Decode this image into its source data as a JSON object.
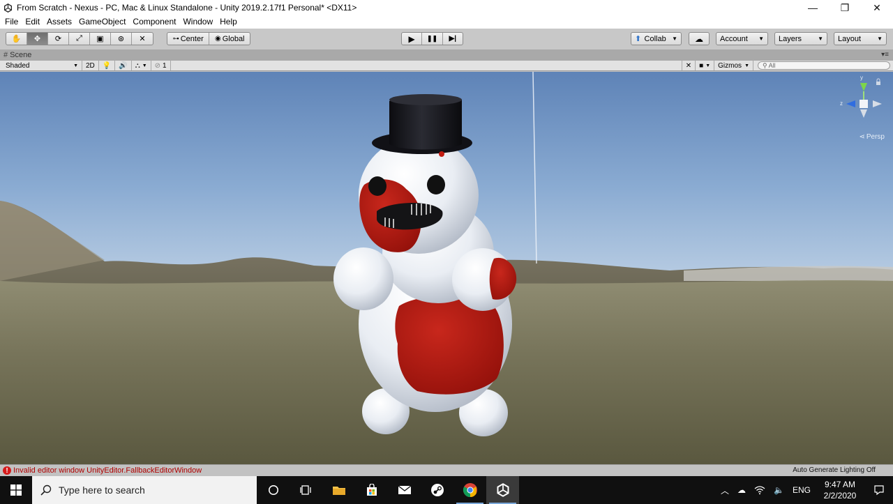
{
  "window": {
    "title": "From Scratch - Nexus - PC, Mac & Linux Standalone - Unity 2019.2.17f1 Personal* <DX11>",
    "minimize_glyph": "—",
    "maximize_glyph": "❐",
    "close_glyph": "✕"
  },
  "menu": [
    "File",
    "Edit",
    "Assets",
    "GameObject",
    "Component",
    "Window",
    "Help"
  ],
  "toolbar": {
    "transform_tools": [
      {
        "name": "hand-tool-icon",
        "glyph": "✋"
      },
      {
        "name": "move-tool-icon",
        "glyph": "✥"
      },
      {
        "name": "rotate-tool-icon",
        "glyph": "⟳"
      },
      {
        "name": "scale-tool-icon",
        "glyph": "⤢"
      },
      {
        "name": "rect-tool-icon",
        "glyph": "▣"
      },
      {
        "name": "transform-tool-icon",
        "glyph": "⊛"
      },
      {
        "name": "custom-tool-icon",
        "glyph": "✕"
      }
    ],
    "pivot_mode": "Center",
    "pivot_rotation": "Global",
    "play_glyph": "▶",
    "pause_glyph": "❚❚",
    "step_glyph": "▶|",
    "collab_label": "Collab",
    "account_label": "Account",
    "layers_label": "Layers",
    "layout_label": "Layout"
  },
  "scene_tab": {
    "label": "Scene"
  },
  "scene_toolbar": {
    "shading_mode": "Shaded",
    "mode_2d": "2D",
    "hidden_count": "1",
    "gizmos_label": "Gizmos",
    "search_placeholder": "All"
  },
  "gizmo": {
    "y_label": "y",
    "z_label": "z",
    "projection": "Persp"
  },
  "status": {
    "error_message": "Invalid editor window UnityEditor.FallbackEditorWindow",
    "right_text": "Auto Generate Lighting Off"
  },
  "taskbar": {
    "search_placeholder": "Type here to search",
    "language": "ENG",
    "time": "9:47 AM",
    "date": "2/2/2020"
  },
  "colors": {
    "accent": "#7aa7d9",
    "error": "#d61a1a",
    "snowman_red": "#b3160e"
  }
}
